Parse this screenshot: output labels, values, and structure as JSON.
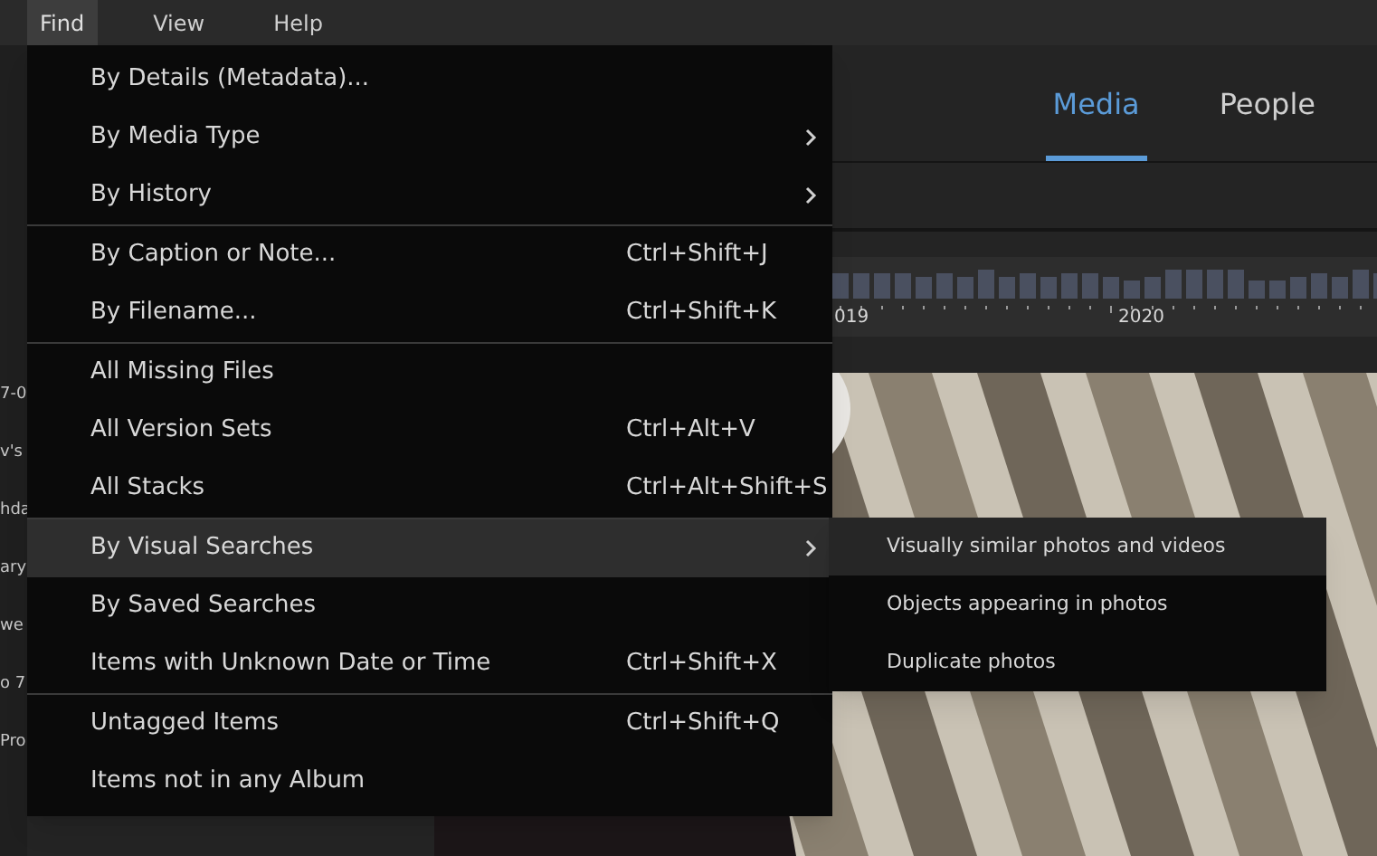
{
  "menubar": [
    {
      "label": "Find",
      "selected": true
    },
    {
      "label": "View",
      "selected": false
    },
    {
      "label": "Help",
      "selected": false
    }
  ],
  "sidebar_fragments": [
    "7-0",
    "v's",
    "hda",
    "ary",
    "we",
    "o 7",
    "Pro"
  ],
  "tabs": [
    {
      "label": "Media",
      "selected": true
    },
    {
      "label": "People",
      "selected": false
    }
  ],
  "timeline": {
    "labels": [
      "019",
      "2020"
    ]
  },
  "find_menu": {
    "groups": [
      [
        {
          "label": "By Details (Metadata)...",
          "submenu": false,
          "selected": false
        },
        {
          "label": "By Media Type",
          "submenu": true,
          "selected": false
        },
        {
          "label": "By History",
          "submenu": true,
          "selected": false
        }
      ],
      [
        {
          "label": "By Caption or Note...",
          "shortcut": "Ctrl+Shift+J",
          "submenu": false,
          "selected": false
        },
        {
          "label": "By Filename...",
          "shortcut": "Ctrl+Shift+K",
          "submenu": false,
          "selected": false
        }
      ],
      [
        {
          "label": "All Missing Files",
          "submenu": false,
          "selected": false
        },
        {
          "label": "All Version Sets",
          "shortcut": "Ctrl+Alt+V",
          "submenu": false,
          "selected": false
        },
        {
          "label": "All Stacks",
          "shortcut": "Ctrl+Alt+Shift+S",
          "submenu": false,
          "selected": false
        }
      ],
      [
        {
          "label": "By Visual Searches",
          "submenu": true,
          "selected": true
        },
        {
          "label": "By Saved Searches",
          "submenu": false,
          "selected": false
        },
        {
          "label": "Items with Unknown Date or Time",
          "shortcut": "Ctrl+Shift+X",
          "submenu": false,
          "selected": false
        }
      ],
      [
        {
          "label": "Untagged Items",
          "shortcut": "Ctrl+Shift+Q",
          "submenu": false,
          "selected": false
        },
        {
          "label": "Items not in any Album",
          "submenu": false,
          "selected": false
        }
      ]
    ]
  },
  "submenu": [
    {
      "label": "Visually similar photos and videos",
      "selected": true
    },
    {
      "label": "Objects appearing in photos",
      "selected": false
    },
    {
      "label": "Duplicate photos",
      "selected": false
    }
  ]
}
